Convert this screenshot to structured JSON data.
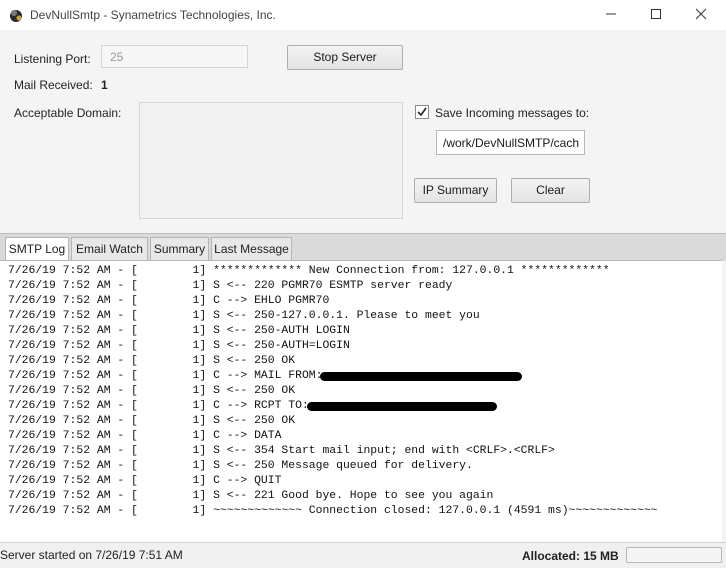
{
  "window": {
    "title": "DevNullSmtp - Synametrics Technologies, Inc."
  },
  "form": {
    "listening_port_label": "Listening Port:",
    "listening_port_value": "25",
    "stop_server_label": "Stop Server",
    "mail_received_label": "Mail Received:",
    "mail_received_value": "1",
    "acceptable_domain_label": "Acceptable Domain:",
    "acceptable_domain_value": "",
    "save_incoming_label": "Save Incoming messages to:",
    "save_incoming_checked": true,
    "save_path_value": "/work/DevNullSMTP/cach",
    "ip_summary_label": "IP Summary",
    "clear_label": "Clear"
  },
  "tabs": [
    {
      "label": "SMTP Log",
      "active": true
    },
    {
      "label": "Email Watch",
      "active": false
    },
    {
      "label": "Summary",
      "active": false
    },
    {
      "label": "Last Message",
      "active": false
    }
  ],
  "log_lines": [
    {
      "prefix": "7/26/19 7:52 AM - [        1] ",
      "text": "************* New Connection from: 127.0.0.1 *************",
      "redacted": false
    },
    {
      "prefix": "7/26/19 7:52 AM - [        1] ",
      "text": "S <-- 220 PGMR70 ESMTP server ready",
      "redacted": false
    },
    {
      "prefix": "7/26/19 7:52 AM - [        1] ",
      "text": "C --> EHLO PGMR70",
      "redacted": false
    },
    {
      "prefix": "7/26/19 7:52 AM - [        1] ",
      "text": "S <-- 250-127.0.0.1. Please to meet you",
      "redacted": false
    },
    {
      "prefix": "7/26/19 7:52 AM - [        1] ",
      "text": "S <-- 250-AUTH LOGIN",
      "redacted": false
    },
    {
      "prefix": "7/26/19 7:52 AM - [        1] ",
      "text": "S <-- 250-AUTH=LOGIN",
      "redacted": false
    },
    {
      "prefix": "7/26/19 7:52 AM - [        1] ",
      "text": "S <-- 250 OK",
      "redacted": false
    },
    {
      "prefix": "7/26/19 7:52 AM - [        1] ",
      "text": "C --> MAIL FROM:",
      "redacted": true
    },
    {
      "prefix": "7/26/19 7:52 AM - [        1] ",
      "text": "S <-- 250 OK",
      "redacted": false
    },
    {
      "prefix": "7/26/19 7:52 AM - [        1] ",
      "text": "C --> RCPT TO:",
      "redacted": true
    },
    {
      "prefix": "7/26/19 7:52 AM - [        1] ",
      "text": "S <-- 250 OK",
      "redacted": false
    },
    {
      "prefix": "7/26/19 7:52 AM - [        1] ",
      "text": "C --> DATA",
      "redacted": false
    },
    {
      "prefix": "7/26/19 7:52 AM - [        1] ",
      "text": "S <-- 354 Start mail input; end with <CRLF>.<CRLF>",
      "redacted": false
    },
    {
      "prefix": "7/26/19 7:52 AM - [        1] ",
      "text": "S <-- 250 Message queued for delivery.",
      "redacted": false
    },
    {
      "prefix": "7/26/19 7:52 AM - [        1] ",
      "text": "C --> QUIT",
      "redacted": false
    },
    {
      "prefix": "7/26/19 7:52 AM - [        1] ",
      "text": "S <-- 221 Good bye. Hope to see you again",
      "redacted": false
    },
    {
      "prefix": "7/26/19 7:52 AM - [        1] ",
      "text": "~~~~~~~~~~~~~ Connection closed: 127.0.0.1 (4591 ms)~~~~~~~~~~~~~",
      "redacted": false
    }
  ],
  "status": {
    "left_text": "Server started on 7/26/19 7:51 AM",
    "allocated_text": "Allocated: 15 MB",
    "memory_fraction": 0.0
  },
  "icons": {
    "app": "app-logo-icon",
    "minimize": "minimize-icon",
    "maximize": "maximize-icon",
    "close": "close-icon",
    "checkbox": "checkmark-icon"
  }
}
